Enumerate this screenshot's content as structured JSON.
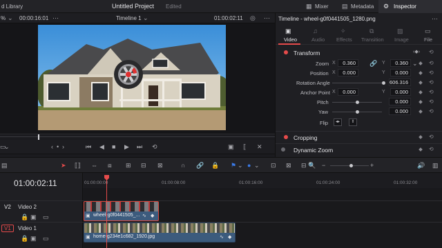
{
  "topbar": {
    "library_label": "d Library",
    "project_title": "Untitled Project",
    "edited_status": "Edited",
    "mixer_label": "Mixer",
    "metadata_label": "Metadata",
    "inspector_label": "Inspector"
  },
  "viewer_bar": {
    "zoom_label": "%",
    "timecode_left": "00:00:16:01",
    "timeline_name": "Timeline 1",
    "timecode_right": "01:00:02:11"
  },
  "inspector": {
    "title": "Timeline - wheel-g0f0441505_1280.png",
    "tabs": [
      {
        "label": "Video",
        "active": true
      },
      {
        "label": "Audio",
        "active": false
      },
      {
        "label": "Effects",
        "active": false
      },
      {
        "label": "Transition",
        "active": false
      },
      {
        "label": "Image",
        "active": false
      },
      {
        "label": "File",
        "active": false
      }
    ],
    "transform_section": "Transform",
    "zoom_label": "Zoom",
    "zoom_x": "0.360",
    "zoom_y": "0.360",
    "position_label": "Position",
    "position_x": "0.000",
    "position_y": "0.000",
    "rotation_label": "Rotation Angle",
    "rotation_value": "606.316",
    "anchor_label": "Anchor Point",
    "anchor_x": "0.000",
    "anchor_y": "0.000",
    "pitch_label": "Pitch",
    "pitch_value": "0.000",
    "yaw_label": "Yaw",
    "yaw_value": "0.000",
    "flip_label": "Flip",
    "x_axis": "X",
    "y_axis": "Y",
    "cropping_section": "Cropping",
    "dynamic_zoom_section": "Dynamic Zoom",
    "accent_color": "#e64b4b"
  },
  "timeline": {
    "current_timecode": "01:00:02:11",
    "ruler_ticks": [
      "01:00:00:00",
      "01:00:08:00",
      "01:00:16:00",
      "01:00:24:00",
      "01:00:32:00"
    ],
    "tracks": [
      {
        "id": "V2",
        "name": "Video 2",
        "clip_label": "wheel-g0f0441505_..."
      },
      {
        "id": "V1",
        "name": "Video 1",
        "clip_label": "home-g234e1c682_1920.jpg"
      }
    ],
    "playhead_color": "#e64b4b",
    "selection_color": "#c0392b"
  }
}
